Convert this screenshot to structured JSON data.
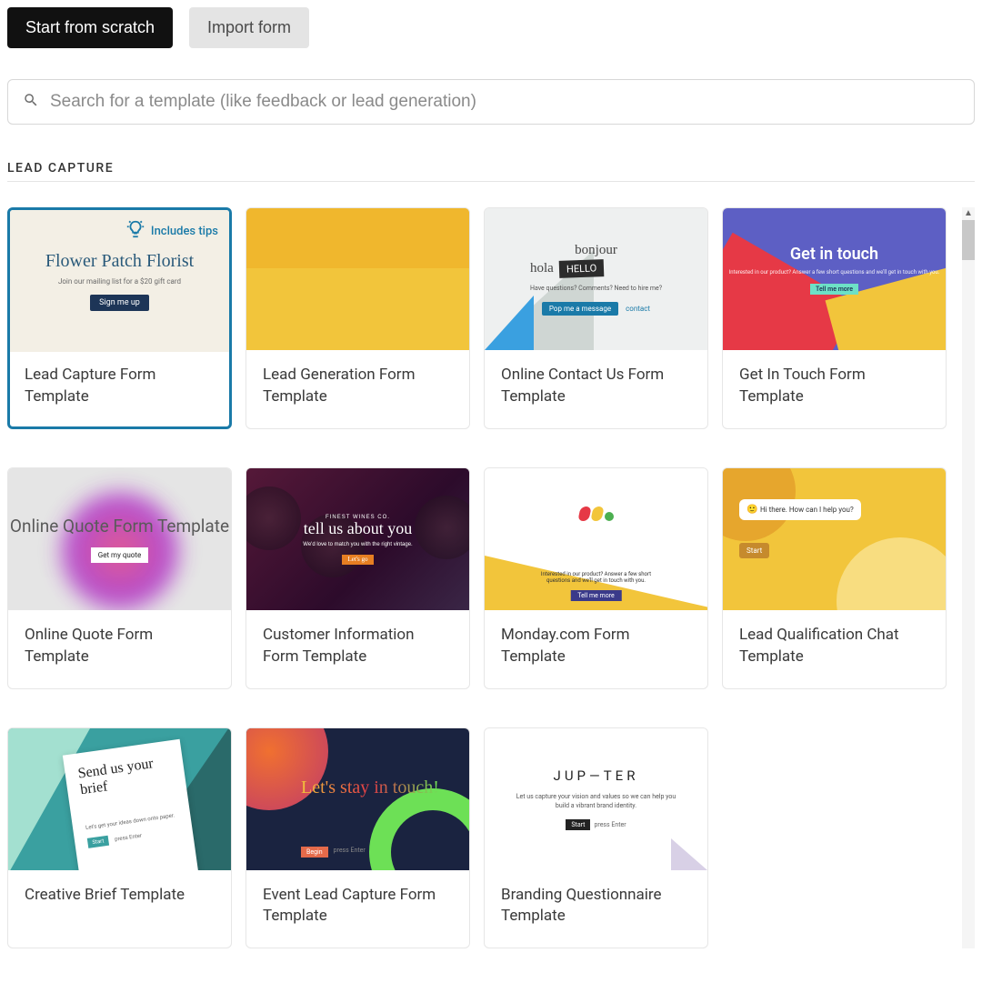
{
  "toolbar": {
    "start_label": "Start from scratch",
    "import_label": "Import form"
  },
  "search": {
    "placeholder": "Search for a template (like feedback or lead generation)"
  },
  "section": {
    "title": "LEAD CAPTURE"
  },
  "tips_badge": "Includes tips",
  "templates": [
    {
      "title": "Lead Capture Form Template",
      "selected": true,
      "includes_tips": true,
      "preview": {
        "heading": "Flower Patch Florist",
        "sub": "Join our mailing list for a $20 gift card",
        "button": "Sign me up"
      }
    },
    {
      "title": "Lead Generation Form Template",
      "preview": {}
    },
    {
      "title": "Online Contact Us Form Template",
      "preview": {
        "bonjour": "bonjour",
        "hola": "hola",
        "hello": "HELLO",
        "sub": "Have questions? Comments? Need to hire me?",
        "button": "Pop me a message",
        "link": "contact"
      }
    },
    {
      "title": "Get In Touch Form Template",
      "preview": {
        "heading": "Get in touch",
        "sub": "Interested in our product?\nAnswer a few short questions and we'll get in touch with you.",
        "button": "Tell me more"
      }
    },
    {
      "title": "Online Quote Form Template",
      "preview": {
        "heading": "Online Quote\nForm Template",
        "button": "Get my quote"
      }
    },
    {
      "title": "Customer Information Form Template",
      "preview": {
        "overline": "FINEST WINES CO.",
        "heading": "tell us about you",
        "sub": "We'd love to match you with the right vintage.",
        "button": "Let's go"
      }
    },
    {
      "title": "Monday.com Form Template",
      "preview": {
        "sub": "Interested in our product?\nAnswer a few short questions and we'll get in touch with you.",
        "button": "Tell me more"
      }
    },
    {
      "title": "Lead Qualification Chat Template",
      "preview": {
        "bubble": "Hi there. How can I help you?",
        "button": "Start"
      }
    },
    {
      "title": "Creative Brief Template",
      "preview": {
        "heading": "Send us your brief",
        "sub": "Let's get your ideas down onto paper.",
        "button": "Start",
        "hint": "press Enter"
      }
    },
    {
      "title": "Event Lead Capture Form Template",
      "preview": {
        "heading": "Let's stay\nin touch!",
        "button": "Begin",
        "hint": "press Enter"
      }
    },
    {
      "title": "Branding Questionnaire Template",
      "preview": {
        "heading": "JUP—TER",
        "sub": "Let us capture your vision and values so we can help you build a vibrant brand identity.",
        "button": "Start",
        "hint": "press Enter"
      }
    }
  ]
}
